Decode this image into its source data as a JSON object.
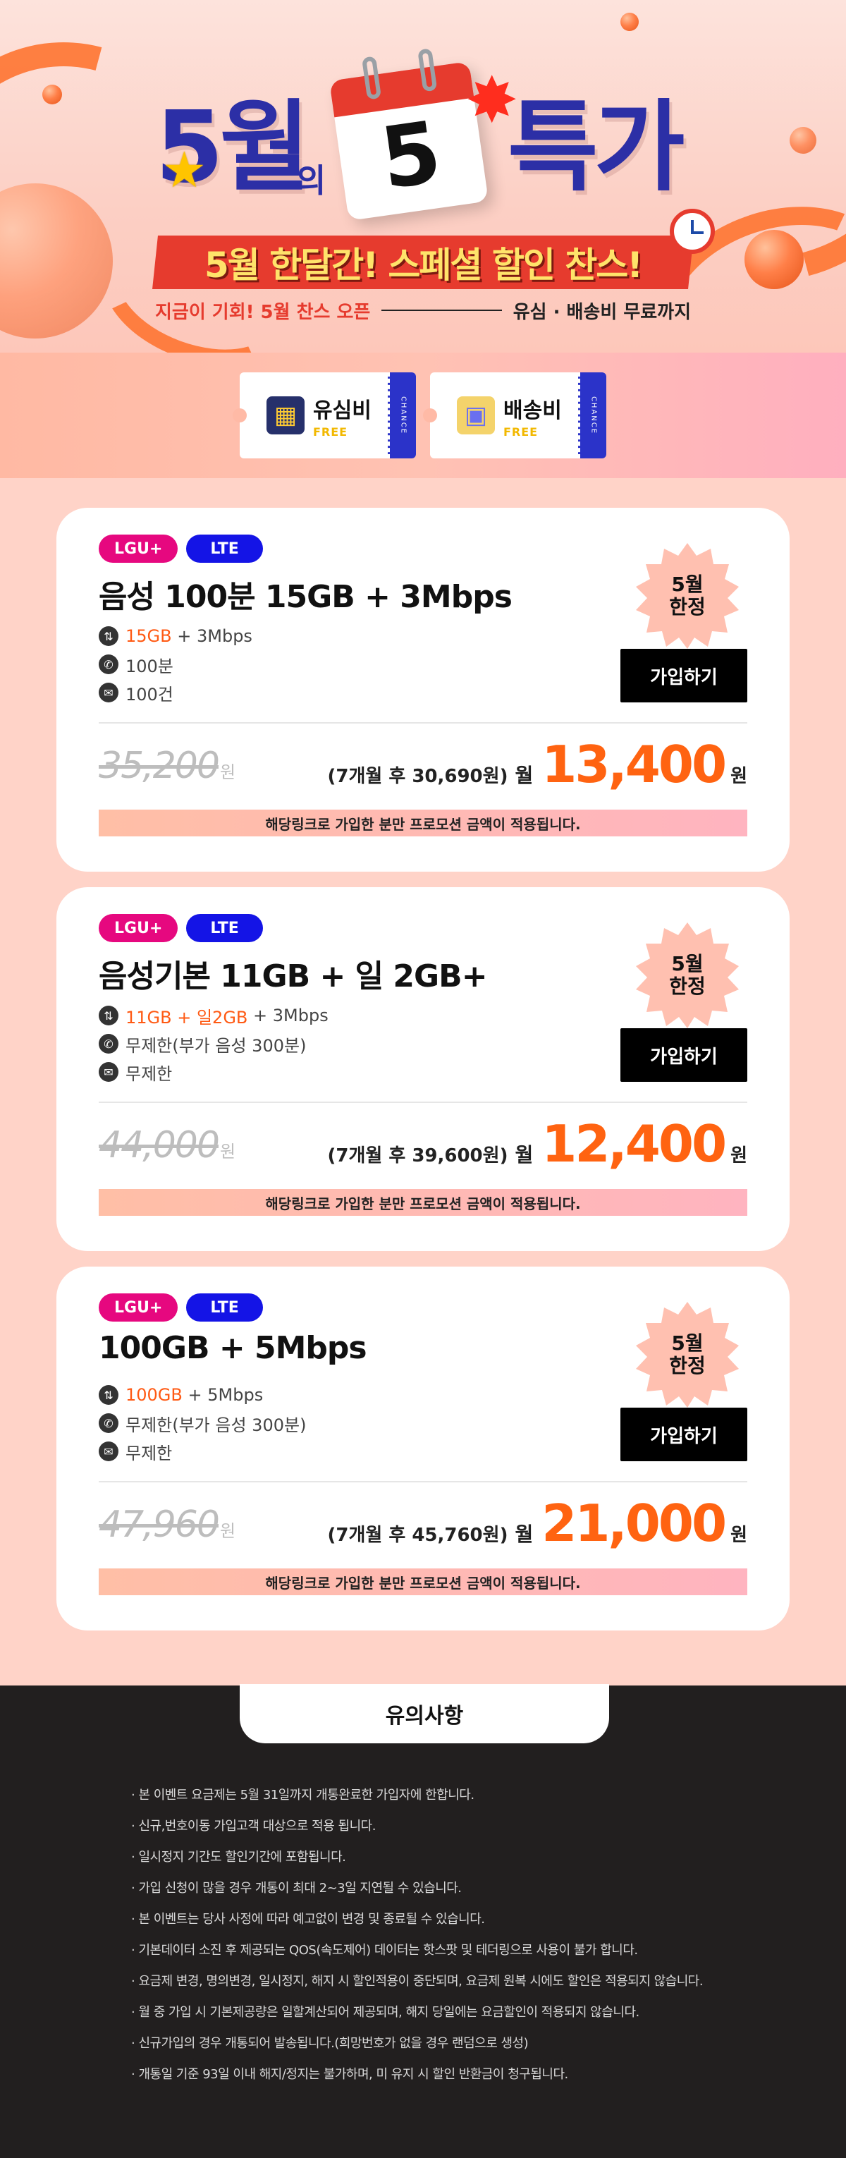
{
  "hero": {
    "title_left": "5월",
    "title_of": "의",
    "calendar_number": "5",
    "title_right": "특가",
    "banner": "5월 한달간! 스페셜 할인 찬스!",
    "sub_left": "지금이 기회! 5월 찬스 오픈",
    "sub_right": "유심 · 배송비 무료까지"
  },
  "coupons": [
    {
      "title": "유심비",
      "free": "FREE",
      "stub": "CHANCE",
      "icon": "sim-card-icon"
    },
    {
      "title": "배송비",
      "free": "FREE",
      "stub": "CHANCE",
      "icon": "delivery-box-icon"
    }
  ],
  "plans": [
    {
      "carrier": "LGU+",
      "network": "LTE",
      "name": "음성 100분 15GB + 3Mbps",
      "data_hl": "15GB",
      "data_rest": " + 3Mbps",
      "voice": "100분",
      "sms": "100건",
      "seal": [
        "5월",
        "한정"
      ],
      "join_label": "가입하기",
      "original_price": "35,200",
      "won": "원",
      "after_note": "(7개월 후 30,690원)",
      "month_label": "월",
      "sale_price": "13,400",
      "promo": "해당링크로 가입한 분만 프로모션 금액이 적용됩니다."
    },
    {
      "carrier": "LGU+",
      "network": "LTE",
      "name": "음성기본 11GB + 일 2GB+",
      "data_hl": "11GB + 일2GB",
      "data_rest": " + 3Mbps",
      "voice": "무제한(부가 음성 300분)",
      "sms": "무제한",
      "seal": [
        "5월",
        "한정"
      ],
      "join_label": "가입하기",
      "original_price": "44,000",
      "won": "원",
      "after_note": "(7개월 후 39,600원)",
      "month_label": "월",
      "sale_price": "12,400",
      "promo": "해당링크로 가입한 분만 프로모션 금액이 적용됩니다."
    },
    {
      "carrier": "LGU+",
      "network": "LTE",
      "name": "100GB + 5Mbps",
      "data_hl": "100GB",
      "data_rest": " + 5Mbps",
      "voice": "무제한(부가 음성 300분)",
      "sms": "무제한",
      "seal": [
        "5월",
        "한정"
      ],
      "join_label": "가입하기",
      "original_price": "47,960",
      "won": "원",
      "after_note": "(7개월 후 45,760원)",
      "month_label": "월",
      "sale_price": "21,000",
      "promo": "해당링크로 가입한 분만 프로모션 금액이 적용됩니다."
    }
  ],
  "notice": {
    "title": "유의사항",
    "items": [
      "본 이벤트 요금제는 5월 31일까지 개통완료한 가입자에 한합니다.",
      "신규,번호이동 가입고객 대상으로 적용 됩니다.",
      "일시정지 기간도 할인기간에 포함됩니다.",
      "가입 신청이 많을 경우 개통이 최대 2~3일 지연될 수 있습니다.",
      "본 이벤트는 당사 사정에 따라 예고없이 변경 및 종료될 수 있습니다.",
      "기본데이터 소진 후 제공되는 QOS(속도제어) 데이터는 핫스팟 및 테더링으로 사용이 불가 합니다.",
      "요금제 변경, 명의변경, 일시정지, 해지 시 할인적용이 중단되며, 요금제 원복 시에도 할인은 적용되지 않습니다.",
      "월 중 가입 시 기본제공량은 일할계산되어 제공되며, 해지 당일에는 요금할인이 적용되지 않습니다.",
      "신규가입의 경우 개통되어 발송됩니다.(희망번호가 없을 경우 랜덤으로 생성)",
      "개통일 기준 93일 이내 해지/정지는 불가하며, 미 유지 시 할인 반환금이 청구됩니다."
    ]
  },
  "colors": {
    "accent": "#ff6311",
    "brand_blue": "#2c2fa6",
    "carrier_pink": "#e6087f",
    "network_blue": "#1414e6",
    "banner_red": "#e63b2e"
  }
}
